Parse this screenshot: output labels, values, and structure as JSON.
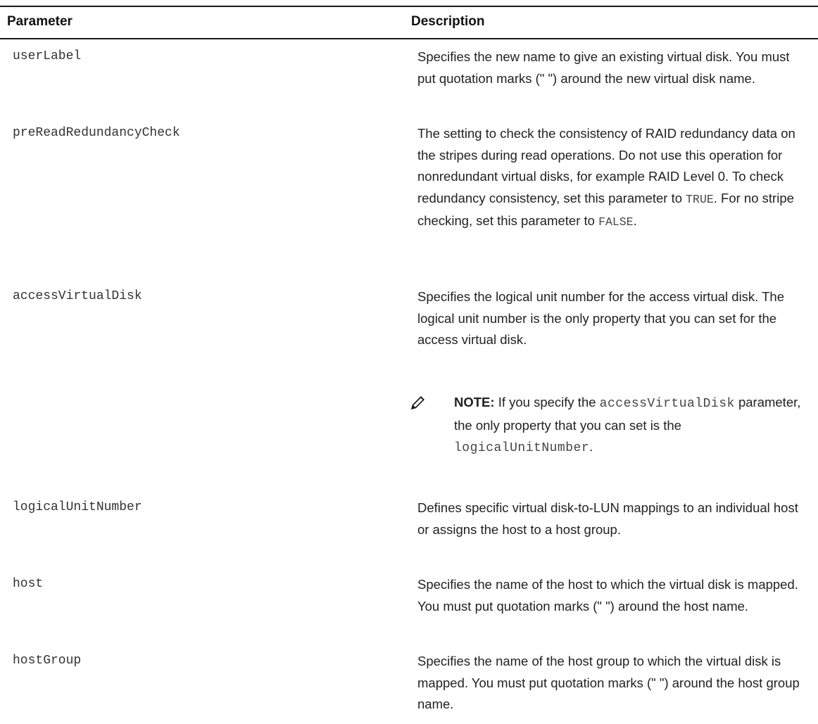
{
  "table": {
    "headers": {
      "parameter": "Parameter",
      "description": "Description"
    },
    "rows": [
      {
        "param": "userLabel",
        "desc": "Specifies the new name to give an existing virtual disk. You must put quotation marks (\" \") around the new virtual disk name."
      },
      {
        "param": "preReadRedundancyCheck",
        "desc_before_true": "The setting to check the consistency of RAID redundancy data on the stripes during read operations. Do not use this operation for nonredundant virtual disks, for example RAID Level 0. To check redundancy consistency, set this parameter to ",
        "true_value": "TRUE",
        "desc_between": ". For no stripe checking, set this parameter to ",
        "false_value": "FALSE",
        "desc_end": "."
      },
      {
        "param": "accessVirtualDisk",
        "desc": "Specifies the logical unit number for the access virtual disk. The logical unit number is the only property that you can set for the access virtual disk.",
        "note": {
          "icon": "pencil-icon",
          "label": "NOTE:",
          "text_before": " If you specify the ",
          "code1": "accessVirtualDisk",
          "text_middle": " parameter, the only property that you can set is the ",
          "code2": "logicalUnitNumber",
          "text_end": "."
        }
      },
      {
        "param": "logicalUnitNumber",
        "desc": "Defines specific virtual disk-to-LUN mappings to an individual host or assigns the host to a host group."
      },
      {
        "param": "host",
        "desc": "Specifies the name of the host to which the virtual disk is mapped. You must put quotation marks (\" \") around the host name."
      },
      {
        "param": "hostGroup",
        "desc": "Specifies the name of the host group to which the virtual disk is mapped. You must put quotation marks (\" \") around the host group name."
      }
    ]
  }
}
